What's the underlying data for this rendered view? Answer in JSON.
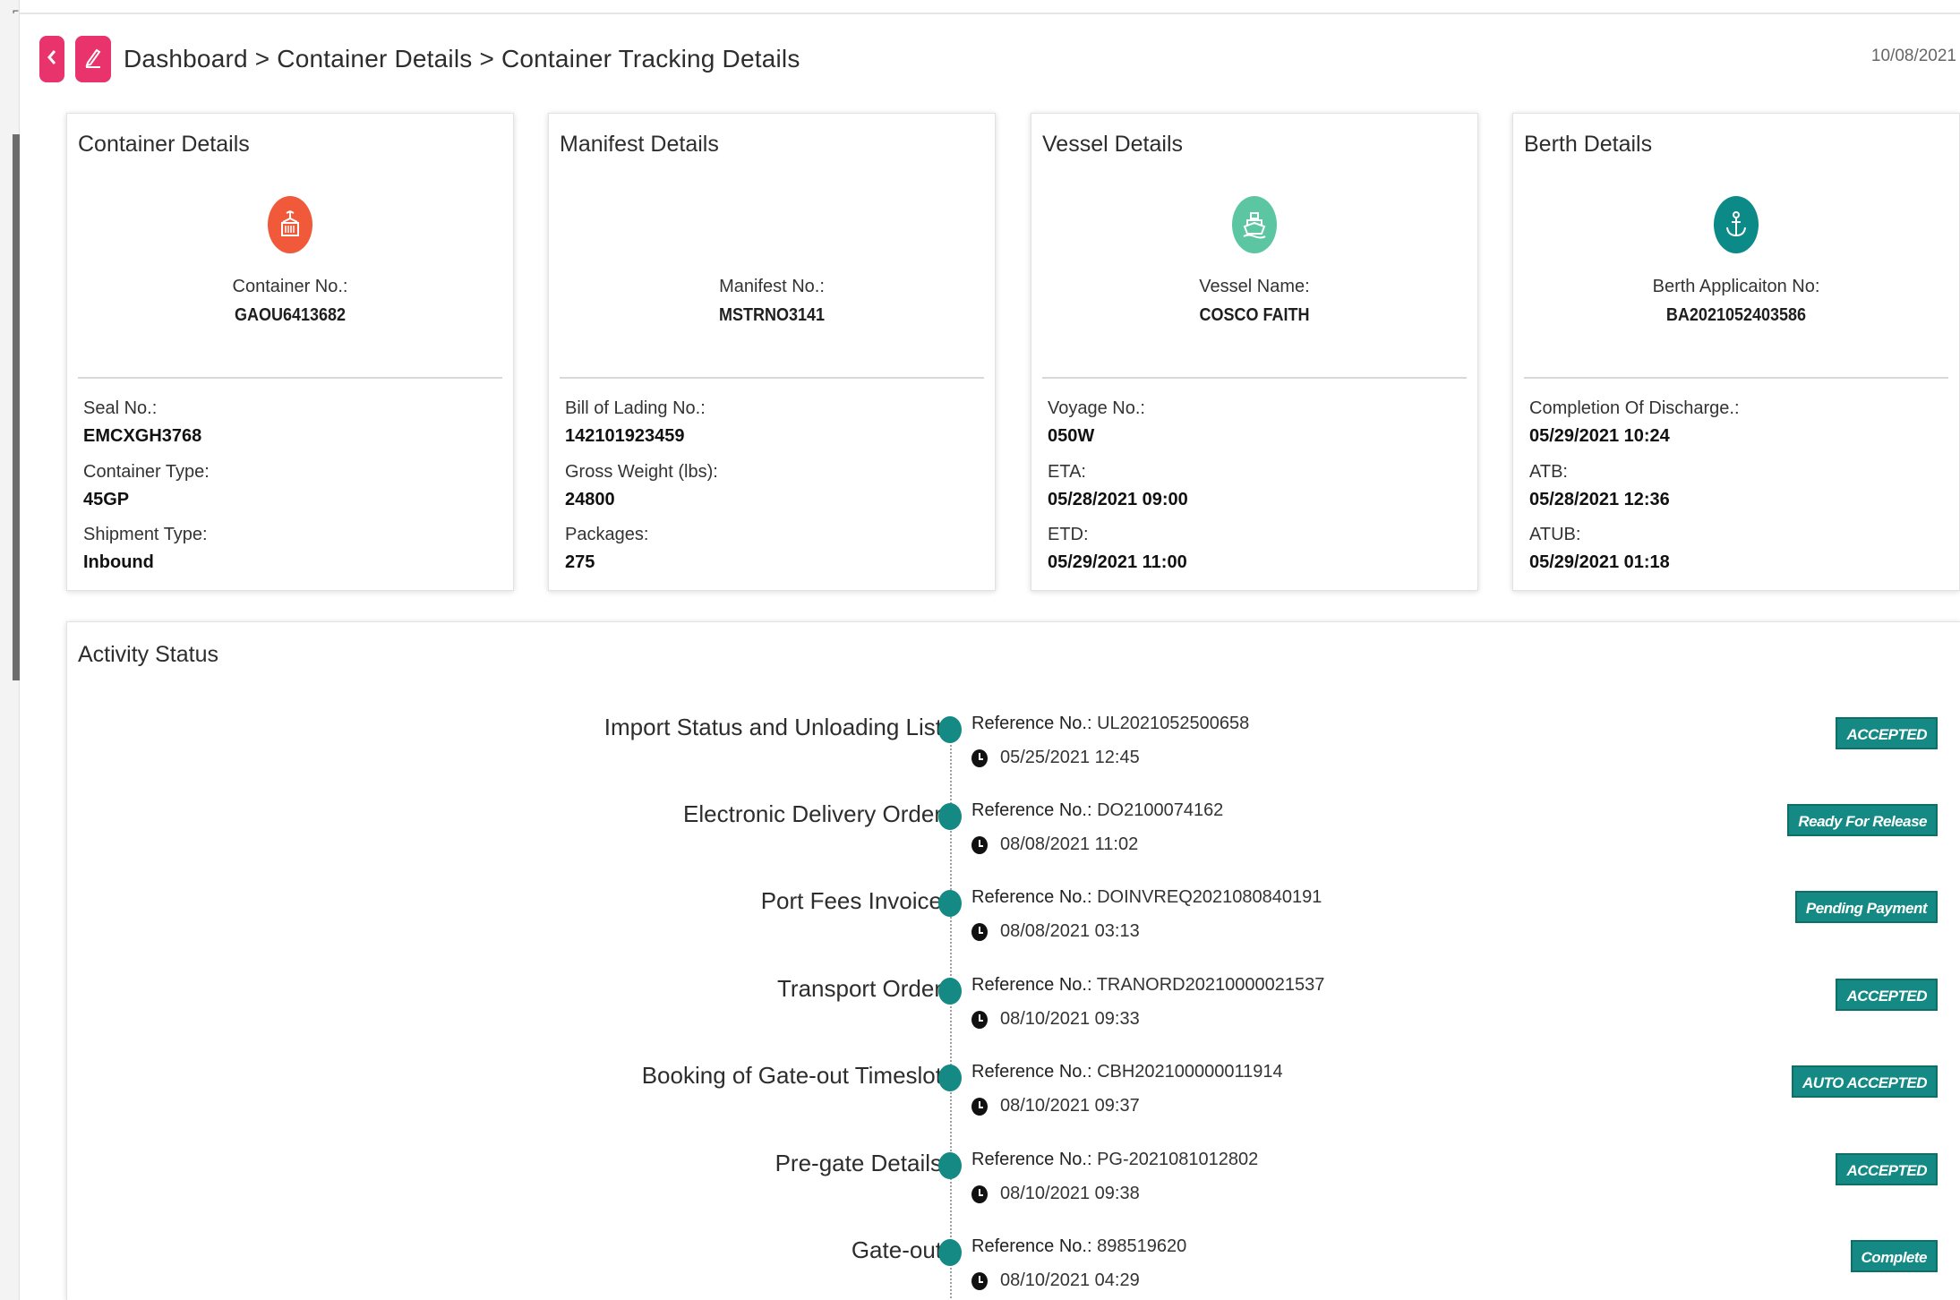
{
  "header": {
    "breadcrumb": "Dashboard > Container Details > Container Tracking Details",
    "date": "10/08/2021"
  },
  "icons": {
    "back": "chevron-left-icon",
    "edit": "pencil-icon",
    "container": "container-crane-icon",
    "vessel": "ship-icon",
    "berth": "anchor-icon",
    "clock": "clock-icon"
  },
  "colors": {
    "accent_pink": "#e8336d",
    "container_icon": "#f0593a",
    "vessel_icon": "#5cc5a2",
    "berth_icon": "#0c8a88",
    "badge": "#158a84"
  },
  "cards": {
    "container": {
      "title": "Container Details",
      "center_label": "Container No.:",
      "center_value": "GAOU6413682",
      "fields": [
        {
          "label": "Seal No.:",
          "value": "EMCXGH3768"
        },
        {
          "label": "Container Type:",
          "value": "45GP"
        },
        {
          "label": "Shipment Type:",
          "value": "Inbound"
        }
      ]
    },
    "manifest": {
      "title": "Manifest Details",
      "center_label": "Manifest No.:",
      "center_value": "MSTRNO3141",
      "fields": [
        {
          "label": "Bill of Lading No.:",
          "value": "142101923459"
        },
        {
          "label": "Gross Weight (lbs):",
          "value": "24800"
        },
        {
          "label": "Packages:",
          "value": "275"
        }
      ]
    },
    "vessel": {
      "title": "Vessel Details",
      "center_label": "Vessel Name:",
      "center_value": "COSCO FAITH",
      "fields": [
        {
          "label": "Voyage No.:",
          "value": "050W"
        },
        {
          "label": "ETA:",
          "value": "05/28/2021 09:00"
        },
        {
          "label": "ETD:",
          "value": "05/29/2021 11:00"
        }
      ]
    },
    "berth": {
      "title": "Berth Details",
      "center_label": "Berth Applicaiton No:",
      "center_value": "BA2021052403586",
      "fields": [
        {
          "label": "Completion Of Discharge.:",
          "value": "05/29/2021 10:24"
        },
        {
          "label": "ATB:",
          "value": "05/28/2021 12:36"
        },
        {
          "label": "ATUB:",
          "value": "05/29/2021 01:18"
        }
      ]
    }
  },
  "activity": {
    "title": "Activity Status",
    "ref_label": "Reference No.:",
    "items": [
      {
        "name": "Import Status and Unloading List",
        "ref": "UL2021052500658",
        "time": "05/25/2021 12:45",
        "status": "ACCEPTED"
      },
      {
        "name": "Electronic Delivery Order",
        "ref": "DO2100074162",
        "time": "08/08/2021 11:02",
        "status": "Ready For Release"
      },
      {
        "name": "Port Fees Invoice",
        "ref": "DOINVREQ2021080840191",
        "time": "08/08/2021 03:13",
        "status": "Pending Payment"
      },
      {
        "name": "Transport Order",
        "ref": "TRANORD20210000021537",
        "time": "08/10/2021 09:33",
        "status": "ACCEPTED"
      },
      {
        "name": "Booking of Gate-out Timeslot",
        "ref": "CBH202100000011914",
        "time": "08/10/2021 09:37",
        "status": "AUTO ACCEPTED"
      },
      {
        "name": "Pre-gate Details",
        "ref": "PG-2021081012802",
        "time": "08/10/2021 09:38",
        "status": "ACCEPTED"
      },
      {
        "name": "Gate-out",
        "ref": "898519620",
        "time": "08/10/2021 04:29",
        "status": "Complete"
      }
    ]
  }
}
